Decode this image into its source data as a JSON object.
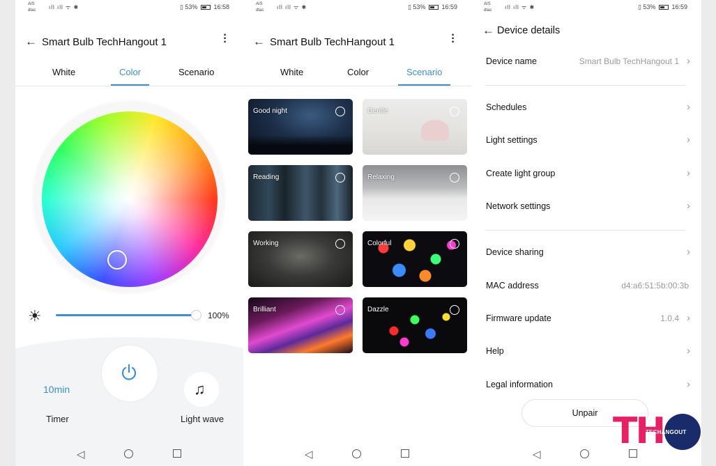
{
  "status": {
    "carrier_line1": "AIS",
    "carrier_line2": "dtac",
    "signal": "ıll ıll ᯤ ✱",
    "battery": "53%",
    "time_1": "16:58",
    "time_2": "16:59",
    "time_3": "16:59"
  },
  "device_title": "Smart Bulb TechHangout 1",
  "tabs": [
    "White",
    "Color",
    "Scenario"
  ],
  "color_screen": {
    "active_tab": "Color",
    "brightness": "100%",
    "brightness_fraction": 1.0,
    "timer_value": "10min",
    "timer_label": "Timer",
    "light_wave_label": "Light wave"
  },
  "scenario_screen": {
    "active_tab": "Scenario",
    "scenes": [
      {
        "label": "Good night"
      },
      {
        "label": "Gentle"
      },
      {
        "label": "Reading"
      },
      {
        "label": "Relaxing"
      },
      {
        "label": "Working"
      },
      {
        "label": "Colorful"
      },
      {
        "label": "Brilliant"
      },
      {
        "label": "Dazzle"
      }
    ]
  },
  "details_screen": {
    "title": "Device details",
    "rows": [
      {
        "label": "Device name",
        "value": "Smart Bulb TechHangout 1"
      },
      {
        "label": "Schedules",
        "value": ""
      },
      {
        "label": "Light settings",
        "value": ""
      },
      {
        "label": "Create light group",
        "value": ""
      },
      {
        "label": "Network settings",
        "value": ""
      },
      {
        "label": "Device sharing",
        "value": ""
      },
      {
        "label": "MAC address",
        "value": "d4:a6:51:5b:00:3b"
      },
      {
        "label": "Firmware update",
        "value": "1.0.4"
      },
      {
        "label": "Help",
        "value": ""
      },
      {
        "label": "Legal information",
        "value": ""
      }
    ],
    "unpair_label": "Unpair"
  },
  "logo": {
    "letters": "TH",
    "text": "TECHANGOUT"
  },
  "colors": {
    "accent": "#3b8fd9",
    "logo_pink": "#e91e63",
    "logo_navy": "#1a2b6b"
  },
  "icons": {
    "back": "arrow-left-icon",
    "more": "more-vertical-icon",
    "brightness": "brightness-icon",
    "power": "power-icon",
    "music": "music-note-icon",
    "chevron": "chevron-right-icon"
  }
}
